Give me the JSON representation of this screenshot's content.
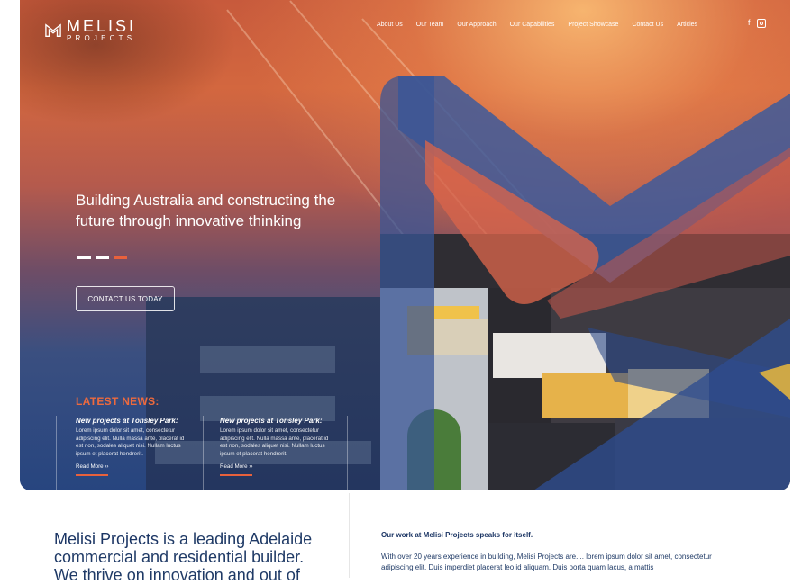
{
  "brand": {
    "name": "MELISI",
    "sub": "PROJECTS",
    "accent": "#e8613c",
    "navy": "#1b3564"
  },
  "nav": [
    {
      "label": "About Us"
    },
    {
      "label": "Our Team"
    },
    {
      "label": "Our Approach"
    },
    {
      "label": "Our Capabilities"
    },
    {
      "label": "Project Showcase"
    },
    {
      "label": "Contact Us"
    },
    {
      "label": "Articles"
    }
  ],
  "social": {
    "facebook": "f",
    "facebook_icon": "facebook-icon",
    "instagram_icon": "instagram-icon"
  },
  "hero": {
    "headline": "Building Australia and constructing the future through innovative thinking",
    "slider_count": 3,
    "slider_active": 3,
    "cta": "CONTACT US TODAY"
  },
  "news": {
    "title": "LATEST NEWS:",
    "items": [
      {
        "title": "New projects at Tonsley Park:",
        "body": "Lorem ipsum dolor sit amet, consectetur adipiscing elit. Nulla massa ante, placerat id est non, sodales aliquet nisi. Nullam luctus ipsum et placerat hendrerit.",
        "more": "Read More ››"
      },
      {
        "title": "New projects at Tonsley Park:",
        "body": "Lorem ipsum dolor sit amet, consectetur adipiscing elit. Nulla massa ante, placerat id est non, sodales aliquet nisi. Nullam luctus ipsum et placerat hendrerit.",
        "more": "Read More ››"
      }
    ]
  },
  "intro": {
    "brand": "Melisi Projects",
    "rest": " is a leading Adelaide commercial and residential builder. We thrive on innovation and out of"
  },
  "work": {
    "title": "Our work at Melisi Projects speaks for itself.",
    "body": "With over 20 years experience in building, Melisi Projects are.... lorem ipsum dolor sit amet, consectetur adipiscing elit. Duis imperdiet placerat leo id aliquam. Duis porta quam lacus, a mattis"
  }
}
